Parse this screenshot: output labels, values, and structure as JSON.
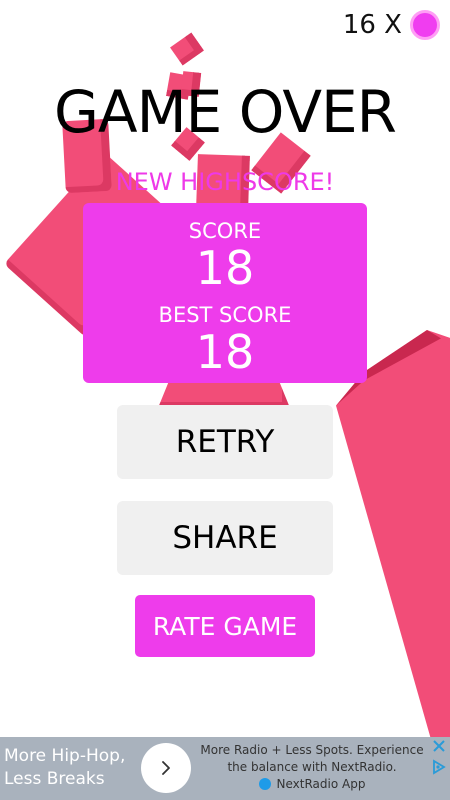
{
  "hud": {
    "coin_count_label": "16 X",
    "coin_icon": "pink-coin-icon"
  },
  "title": "GAME OVER",
  "new_highscore_label": "NEW HIGHSCORE!",
  "score_card": {
    "score_label": "SCORE",
    "score_value": "18",
    "best_label": "BEST SCORE",
    "best_value": "18"
  },
  "buttons": {
    "retry": "RETRY",
    "share": "SHARE",
    "rate": "RATE GAME"
  },
  "ad": {
    "headline": "More Hip-Hop, Less Breaks",
    "body": "More Radio + Less Spots. Experience the balance with NextRadio.",
    "app_name": "NextRadio App",
    "arrow_icon": "chevron-right-icon",
    "close_icon": "close-icon",
    "choices_icon": "adchoices-icon"
  },
  "colors": {
    "accent_magenta": "#ee3ceb",
    "block_pink": "#f24d78",
    "button_grey": "#f0f0f0",
    "ad_background": "#a9b2bd"
  }
}
